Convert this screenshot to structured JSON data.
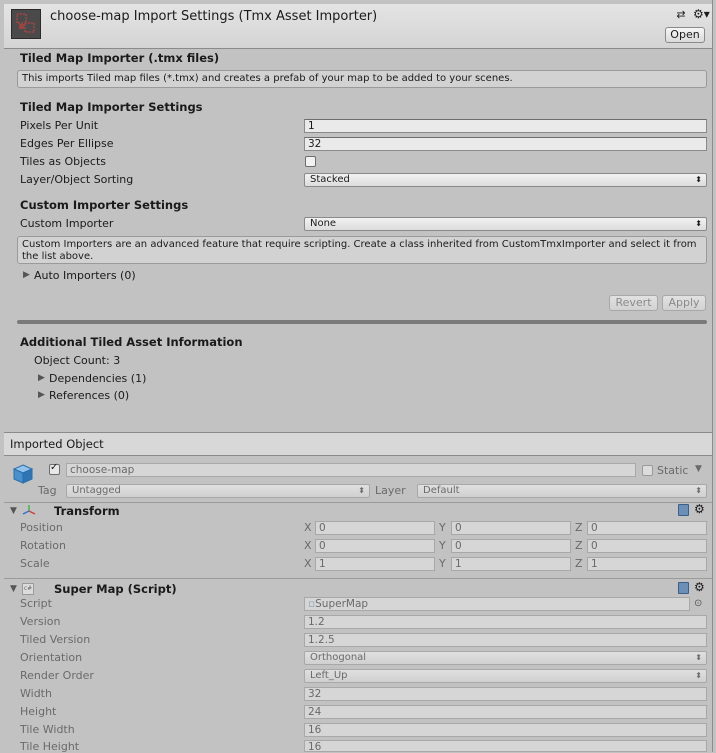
{
  "title_bar": {
    "title": "choose-map Import Settings (Tmx Asset Importer)",
    "open_label": "Open"
  },
  "importer": {
    "section_title": "Tiled Map Importer (.tmx files)",
    "description": "This imports Tiled map files (*.tmx) and creates a prefab of your map to be added to your scenes.",
    "settings_title": "Tiled Map Importer Settings",
    "pixels_per_unit_label": "Pixels Per Unit",
    "pixels_per_unit_value": "1",
    "edges_per_ellipse_label": "Edges Per Ellipse",
    "edges_per_ellipse_value": "32",
    "tiles_as_objects_label": "Tiles as Objects",
    "tiles_as_objects_checked": false,
    "sorting_label": "Layer/Object Sorting",
    "sorting_value": "Stacked",
    "custom_title": "Custom Importer Settings",
    "custom_label": "Custom Importer",
    "custom_value": "None",
    "custom_help": "Custom Importers are an advanced feature that require scripting. Create a class inherited from CustomTmxImporter and select it from the list above.",
    "auto_importers_label": "Auto Importers (0)",
    "revert_label": "Revert",
    "apply_label": "Apply"
  },
  "additional": {
    "title": "Additional Tiled Asset Information",
    "object_count": "Object Count: 3",
    "dependencies": "Dependencies (1)",
    "references": "References (0)"
  },
  "imported_object": {
    "header": "Imported Object",
    "name": "choose-map",
    "static_label": "Static",
    "tag_label": "Tag",
    "tag_value": "Untagged",
    "layer_label": "Layer",
    "layer_value": "Default"
  },
  "transform": {
    "title": "Transform",
    "rows": [
      {
        "label": "Position",
        "x": "0",
        "y": "0",
        "z": "0"
      },
      {
        "label": "Rotation",
        "x": "0",
        "y": "0",
        "z": "0"
      },
      {
        "label": "Scale",
        "x": "1",
        "y": "1",
        "z": "1"
      }
    ],
    "axis_x": "X",
    "axis_y": "Y",
    "axis_z": "Z"
  },
  "super_map": {
    "title": "Super Map (Script)",
    "script_label": "Script",
    "script_value": "SuperMap",
    "version_label": "Version",
    "version_value": "1.2",
    "tiled_version_label": "Tiled Version",
    "tiled_version_value": "1.2.5",
    "orientation_label": "Orientation",
    "orientation_value": "Orthogonal",
    "render_order_label": "Render Order",
    "render_order_value": "Left_Up",
    "width_label": "Width",
    "width_value": "32",
    "height_label": "Height",
    "height_value": "24",
    "tile_width_label": "Tile Width",
    "tile_width_value": "16",
    "tile_height_label": "Tile Height",
    "tile_height_value": "16"
  }
}
